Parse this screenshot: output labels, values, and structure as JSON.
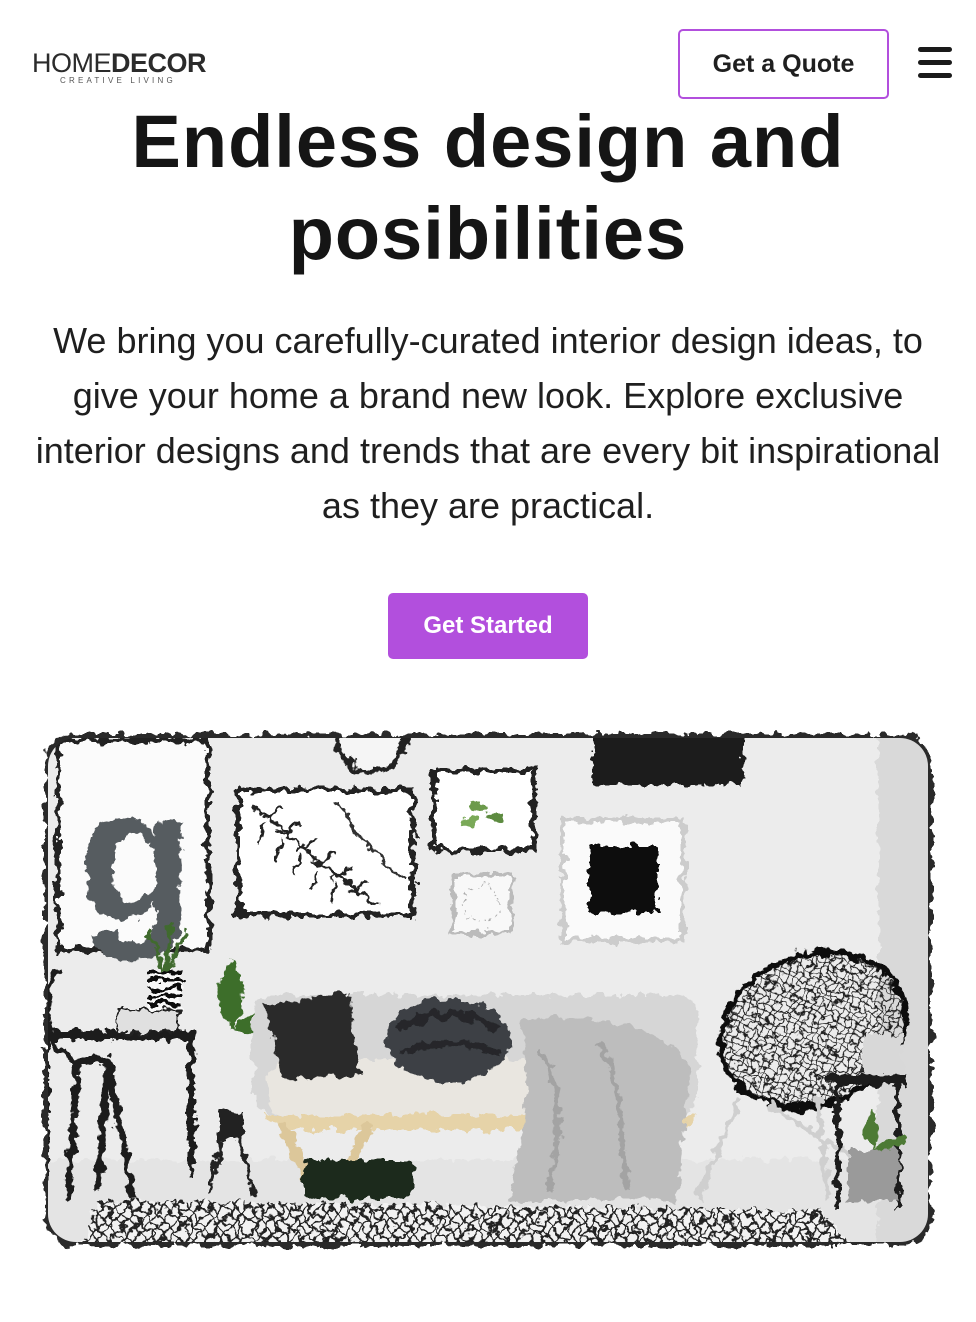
{
  "header": {
    "logo": {
      "main_light": "HOME",
      "main_bold": "DECOR",
      "tagline": "CREATIVE LIVING"
    },
    "quote_button": "Get a Quote",
    "menu_icon": "hamburger-menu-icon"
  },
  "hero": {
    "title": "Endless design and posibilities",
    "description": "We bring you carefully-curated interior design ideas, to give your home a brand new look. Explore exclusive interior designs and trends that are every bit inspirational as they are practical.",
    "cta_button": "Get Started"
  },
  "colors": {
    "accent": "#b24fdd",
    "text": "#1a1a1a",
    "background": "#ffffff"
  }
}
